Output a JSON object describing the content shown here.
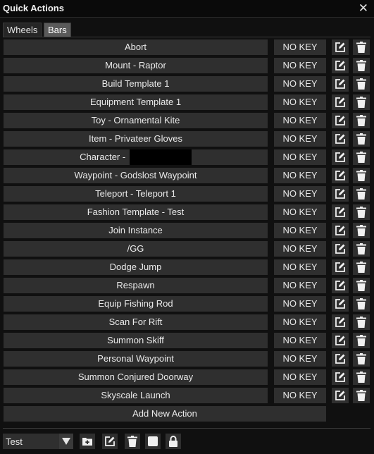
{
  "window": {
    "title": "Quick Actions",
    "close_glyph": "✕"
  },
  "tabs": [
    {
      "label": "Wheels",
      "active": false
    },
    {
      "label": "Bars",
      "active": true
    }
  ],
  "actions": [
    {
      "label": "Abort",
      "key": "NO KEY"
    },
    {
      "label": "Mount - Raptor",
      "key": "NO KEY"
    },
    {
      "label": "Build Template 1",
      "key": "NO KEY"
    },
    {
      "label": "Equipment Template 1",
      "key": "NO KEY"
    },
    {
      "label": "Toy - Ornamental Kite",
      "key": "NO KEY"
    },
    {
      "label": "Item - Privateer Gloves",
      "key": "NO KEY"
    },
    {
      "label": "Character - ",
      "key": "NO KEY",
      "redacted": true
    },
    {
      "label": "Waypoint - Godslost Waypoint",
      "key": "NO KEY"
    },
    {
      "label": "Teleport - Teleport 1",
      "key": "NO KEY"
    },
    {
      "label": "Fashion Template - Test",
      "key": "NO KEY"
    },
    {
      "label": "Join Instance",
      "key": "NO KEY"
    },
    {
      "label": "/GG",
      "key": "NO KEY"
    },
    {
      "label": "Dodge Jump",
      "key": "NO KEY"
    },
    {
      "label": "Respawn",
      "key": "NO KEY"
    },
    {
      "label": "Equip Fishing Rod",
      "key": "NO KEY"
    },
    {
      "label": "Scan For Rift",
      "key": "NO KEY"
    },
    {
      "label": "Summon Skiff",
      "key": "NO KEY"
    },
    {
      "label": "Personal Waypoint",
      "key": "NO KEY"
    },
    {
      "label": "Summon Conjured Doorway",
      "key": "NO KEY"
    },
    {
      "label": "Skyscale Launch",
      "key": "NO KEY"
    }
  ],
  "add_action_label": "Add New Action",
  "footer": {
    "profile_select_value": "Test",
    "toolbar_icons": [
      "add-icon",
      "edit-icon",
      "trash-icon",
      "stop-icon",
      "lock-icon"
    ]
  },
  "colors": {
    "background": "#101010",
    "button": "#2f2f2f",
    "active_tab": "#5a5a5a",
    "text": "#eaeaea"
  }
}
